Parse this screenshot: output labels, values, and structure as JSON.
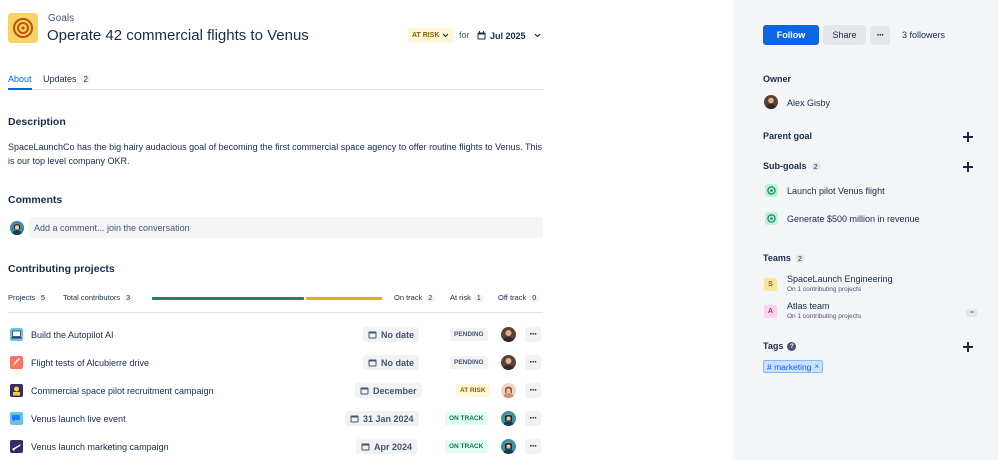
{
  "header": {
    "breadcrumb": "Goals",
    "title": "Operate 42 commercial flights to Venus",
    "status": "AT RISK",
    "for_label": "for",
    "date": "Jul 2025"
  },
  "tabs": [
    {
      "label": "About"
    },
    {
      "label": "Updates",
      "count": "2"
    }
  ],
  "description": {
    "heading": "Description",
    "text": "SpaceLaunchCo has the big hairy audacious goal of becoming the first commercial space agency to offer routine flights to Venus. This is our top level company OKR."
  },
  "comments": {
    "heading": "Comments",
    "placeholder": "Add a comment... join the conversation"
  },
  "projects": {
    "heading": "Contributing projects",
    "projects_label": "Projects",
    "projects_count": "5",
    "contributors_label": "Total contributors",
    "contributors_count": "3",
    "on_track_label": "On track",
    "on_track_count": "2",
    "at_risk_label": "At risk",
    "at_risk_count": "1",
    "off_track_label": "Off track",
    "off_track_count": "0",
    "progress": {
      "on_track_fraction": 0.66,
      "at_risk_fraction": 0.34
    },
    "rows": [
      {
        "name": "Build the Autopilot AI",
        "date": "No date",
        "status": "PENDING",
        "status_kind": "pending"
      },
      {
        "name": "Flight tests of Alcubierre drive",
        "date": "No date",
        "status": "PENDING",
        "status_kind": "pending"
      },
      {
        "name": "Commercial space pilot recruitment campaign",
        "date": "December",
        "status": "AT RISK",
        "status_kind": "risk"
      },
      {
        "name": "Venus launch live event",
        "date": "31 Jan 2024",
        "status": "ON TRACK",
        "status_kind": "ontrack"
      },
      {
        "name": "Venus launch marketing campaign",
        "date": "Apr 2024",
        "status": "ON TRACK",
        "status_kind": "ontrack"
      }
    ]
  },
  "sidebar": {
    "follow_label": "Follow",
    "share_label": "Share",
    "followers": "3 followers",
    "owner_heading": "Owner",
    "owner_name": "Alex Gisby",
    "parent_goal_heading": "Parent goal",
    "subgoals_heading": "Sub-goals",
    "subgoals_count": "2",
    "subgoals": [
      {
        "name": "Launch pilot Venus flight"
      },
      {
        "name": "Generate $500 million in revenue"
      }
    ],
    "teams_heading": "Teams",
    "teams_count": "2",
    "teams": [
      {
        "initial": "S",
        "name": "SpaceLaunch Engineering",
        "sub": "On 1 contributing projects",
        "color": "#f8e6a0",
        "text_color": "#7f5f01"
      },
      {
        "initial": "A",
        "name": "Atlas team",
        "sub": "On 1 contributing projects",
        "color": "#fdd0ec",
        "text_color": "#943d73"
      }
    ],
    "tags_heading": "Tags",
    "tag": "# marketing",
    "tag_remove": "×"
  },
  "colors": {
    "accent": "#0c66e4",
    "on_track": "#1f845a",
    "at_risk": "#e2b203"
  }
}
